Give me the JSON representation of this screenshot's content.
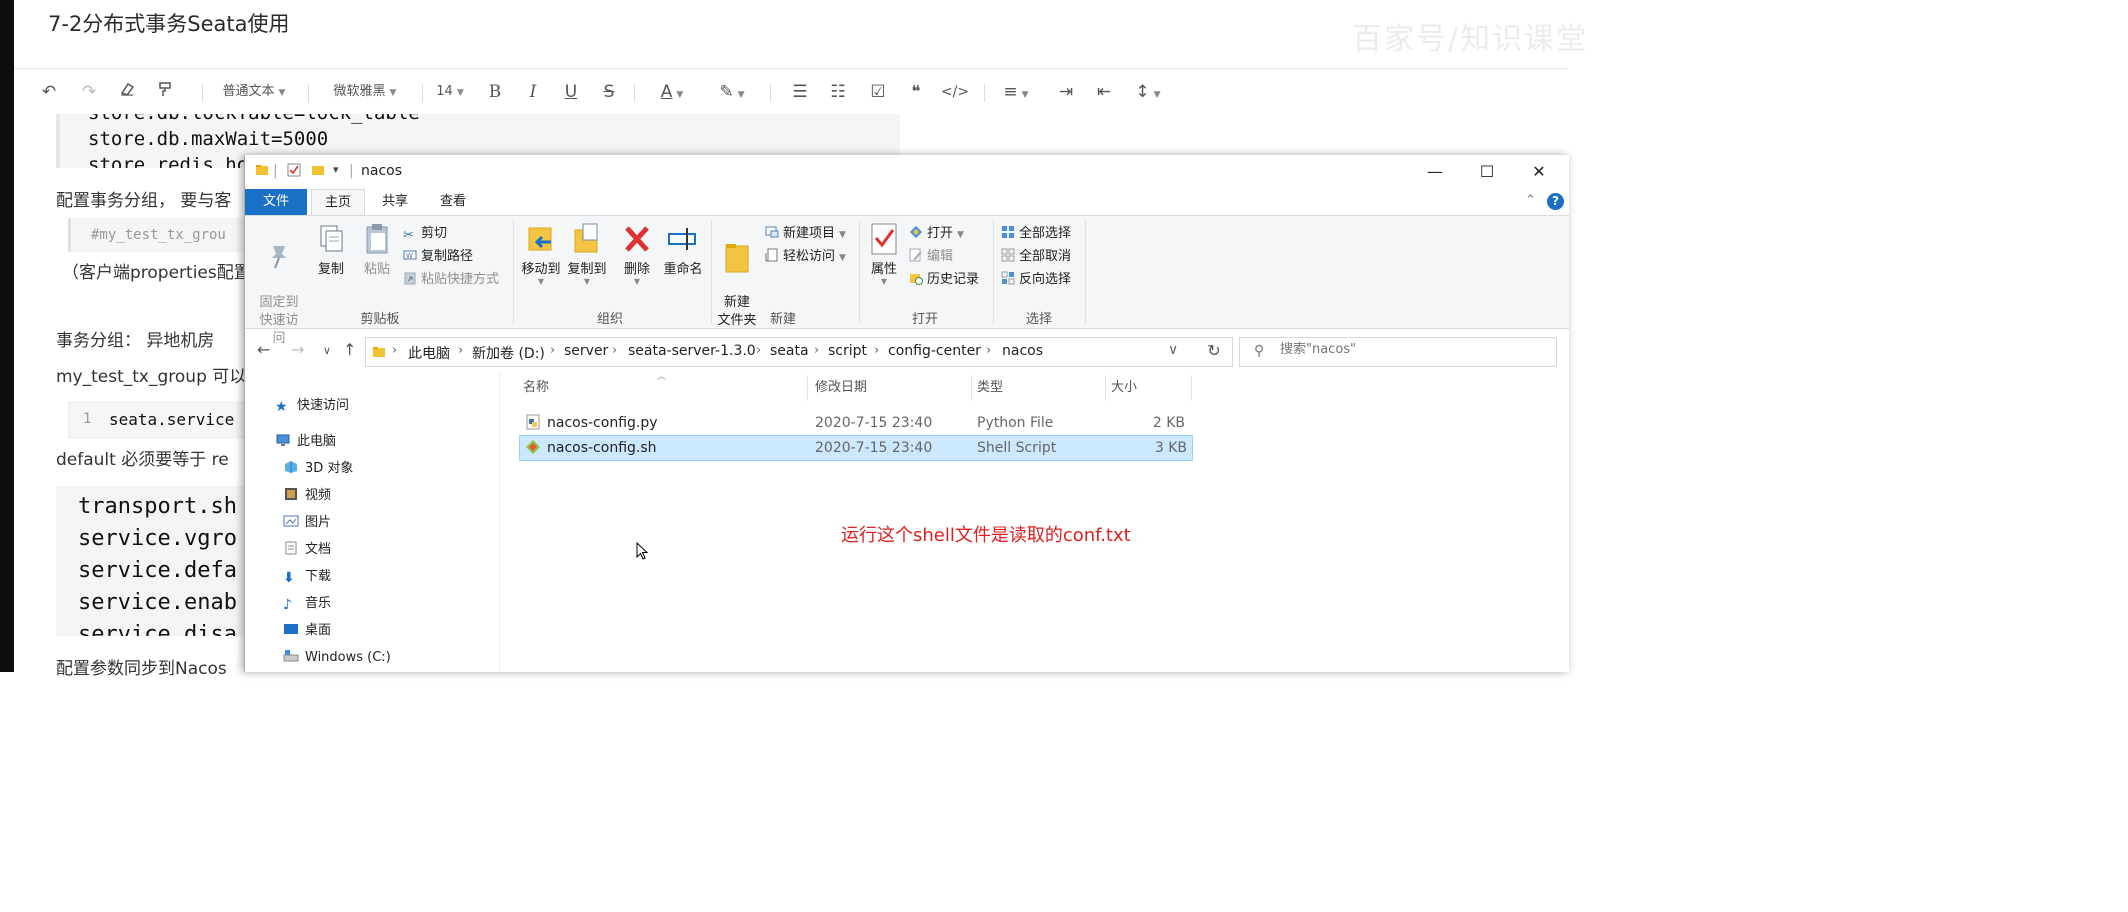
{
  "doc": {
    "title": "7-2分布式事务Seata使用",
    "watermark": "百家号/知识课堂",
    "toolbar": {
      "undo_icon": "undo-icon",
      "redo_icon": "redo-icon",
      "eraser_icon": "eraser-icon",
      "format_painter_icon": "format-painter-icon",
      "paragraph_style": "普通文本",
      "font_family": "微软雅黑",
      "font_size": "14",
      "bold": "B",
      "italic": "I",
      "underline": "U",
      "strike": "S",
      "font_color": "A",
      "highlight_icon": "highlighter-icon",
      "checklist_icon": "checklist-icon",
      "quote": "❝",
      "code": "</>"
    },
    "code_block_1": [
      "store.db.lockTable=lock_table",
      "store.db.maxWait=5000",
      "store.redis.host"
    ],
    "para_1": "配置事务分组，  要与客",
    "code_block_2": "#my_test_tx_grou",
    "para_2": "（客户端properties配置",
    "para_3": "事务分组：   异地机房",
    "para_4": "my_test_tx_group 可以",
    "code_block_3": {
      "line_no": "1",
      "text": "seata.service"
    },
    "para_5": "default   必须要等于 re",
    "code_block_4": [
      "transport.sh",
      "service.vgro",
      "service.defa",
      "service.enab",
      "service.disa"
    ],
    "para_6": "配置参数同步到Nacos"
  },
  "explorer": {
    "window_title": "nacos",
    "window_buttons": {
      "minimize": "—",
      "maximize": "☐",
      "close": "✕"
    },
    "ribbon_tabs": [
      "文件",
      "主页",
      "共享",
      "查看"
    ],
    "help": "?",
    "groups": {
      "clipboard": {
        "label": "剪贴板",
        "pin": "固定到\n快速访问",
        "copy": "复制",
        "paste": "粘贴",
        "cut": "剪切",
        "copy_path": "复制路径",
        "paste_shortcut": "粘贴快捷方式"
      },
      "organize": {
        "label": "组织",
        "move_to": "移动到",
        "copy_to": "复制到",
        "delete": "删除",
        "rename": "重命名"
      },
      "new": {
        "label": "新建",
        "new_folder": "新建\n文件夹",
        "new_item": "新建项目",
        "easy_access": "轻松访问"
      },
      "open": {
        "label": "打开",
        "properties": "属性",
        "open": "打开",
        "edit": "编辑",
        "history": "历史记录"
      },
      "select": {
        "label": "选择",
        "select_all": "全部选择",
        "select_none": "全部取消",
        "invert": "反向选择"
      }
    },
    "breadcrumb": [
      "此电脑",
      "新加卷 (D:)",
      "server",
      "seata-server-1.3.0",
      "seata",
      "script",
      "config-center",
      "nacos"
    ],
    "search_placeholder": "搜索\"nacos\"",
    "nav_items": [
      {
        "label": "快速访问",
        "icon": "star-icon"
      },
      {
        "label": "此电脑",
        "icon": "computer-icon"
      },
      {
        "label": "3D 对象",
        "icon": "cube-icon"
      },
      {
        "label": "视频",
        "icon": "video-icon"
      },
      {
        "label": "图片",
        "icon": "picture-icon"
      },
      {
        "label": "文档",
        "icon": "document-icon"
      },
      {
        "label": "下载",
        "icon": "download-icon"
      },
      {
        "label": "音乐",
        "icon": "music-icon"
      },
      {
        "label": "桌面",
        "icon": "desktop-icon"
      },
      {
        "label": "Windows (C:)",
        "icon": "drive-icon"
      }
    ],
    "columns": [
      "名称",
      "修改日期",
      "类型",
      "大小"
    ],
    "files": [
      {
        "name": "nacos-config.py",
        "date": "2020-7-15 23:40",
        "type": "Python File",
        "size": "2 KB",
        "selected": false
      },
      {
        "name": "nacos-config.sh",
        "date": "2020-7-15 23:40",
        "type": "Shell Script",
        "size": "3 KB",
        "selected": true
      }
    ],
    "annotation": "运行这个shell文件是读取的conf.txt",
    "colors": {
      "accent": "#1a6fc7",
      "selection": "#cce8ff",
      "annotation": "#e02020"
    }
  }
}
